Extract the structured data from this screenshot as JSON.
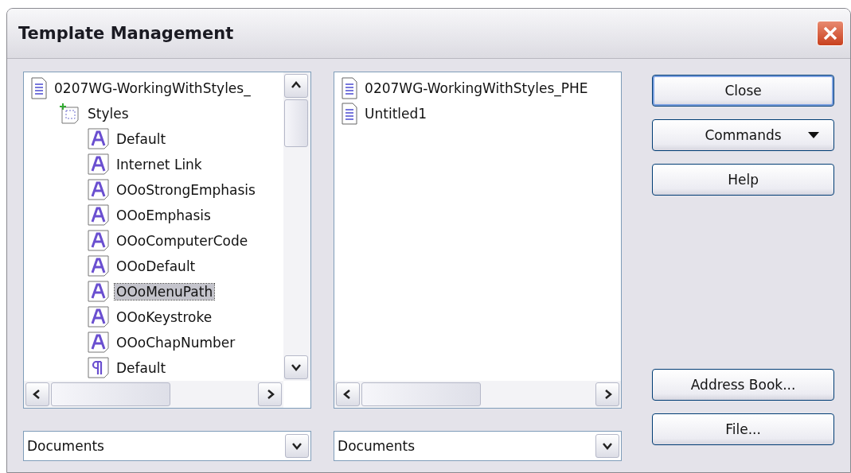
{
  "window": {
    "title": "Template Management"
  },
  "left_panel": {
    "tree": [
      {
        "label": "0207WG-WorkingWithStyles_",
        "kind": "document",
        "selected": false,
        "children": [
          {
            "label": "Styles",
            "kind": "folder",
            "selected": false,
            "children": [
              {
                "label": "Default",
                "kind": "character",
                "selected": false
              },
              {
                "label": "Internet Link",
                "kind": "character",
                "selected": false
              },
              {
                "label": "OOoStrongEmphasis",
                "kind": "character",
                "selected": false
              },
              {
                "label": "OOoEmphasis",
                "kind": "character",
                "selected": false
              },
              {
                "label": "OOoComputerCode",
                "kind": "character",
                "selected": false
              },
              {
                "label": "OOoDefault",
                "kind": "character",
                "selected": false
              },
              {
                "label": "OOoMenuPath",
                "kind": "character",
                "selected": true
              },
              {
                "label": "OOoKeystroke",
                "kind": "character",
                "selected": false
              },
              {
                "label": "OOoChapNumber",
                "kind": "character",
                "selected": false
              },
              {
                "label": "Default",
                "kind": "paragraph",
                "selected": false
              }
            ]
          }
        ]
      }
    ],
    "dropdown": {
      "value": "Documents"
    }
  },
  "right_panel": {
    "tree": [
      {
        "label": "0207WG-WorkingWithStyles_PHE",
        "kind": "document",
        "selected": false
      },
      {
        "label": "Untitled1",
        "kind": "document",
        "selected": false
      }
    ],
    "dropdown": {
      "value": "Documents"
    }
  },
  "buttons_top": [
    {
      "label": "Close",
      "kind": "default"
    },
    {
      "label": "Commands",
      "kind": "menu"
    },
    {
      "label": "Help",
      "kind": "plain"
    }
  ],
  "buttons_bottom": [
    {
      "label": "Address Book...",
      "kind": "plain"
    },
    {
      "label": "File...",
      "kind": "plain"
    }
  ]
}
